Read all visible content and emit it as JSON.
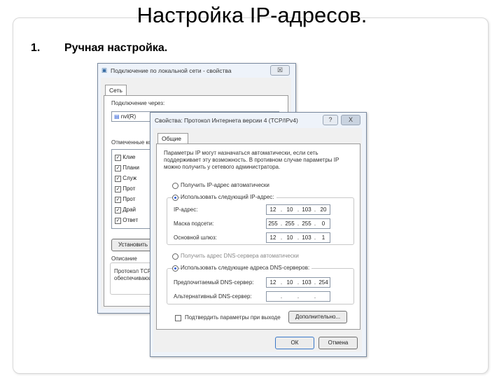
{
  "slide": {
    "title": "Настройка IP-адресов.",
    "item_number": "1.",
    "item_text": "Ручная настройка."
  },
  "back_window": {
    "title": "Подключение по локальной сети - свойства",
    "close": "☒",
    "tab": "Сеть",
    "connect_using_label": "Подключение через:",
    "adapter_name": "nvl(R)",
    "components_label": "Отмеченные компоненты используются этим подключением:",
    "items": [
      "Клие",
      "Плани",
      "Служ",
      "Прот",
      "Прот",
      "Драй",
      "Ответ"
    ],
    "install_button": "Установить",
    "description_label": "Описание",
    "description_text": "Протокол TCP/IP - стандартный протокол сетей, обеспечивающий связь между..."
  },
  "front_window": {
    "title": "Свойства: Протокол Интернета версии 4 (TCP/IPv4)",
    "help": "?",
    "close": "X",
    "tab": "Общие",
    "intro": "Параметры IP могут назначаться автоматически, если сеть поддерживает эту возможность. В противном случае параметры IP можно получить у сетевого администратора.",
    "radio_ip_auto": "Получить IP-адрес автоматически",
    "radio_ip_manual": "Использовать следующий IP-адрес:",
    "ip_label": "IP-адрес:",
    "ip_value": [
      "12",
      "10",
      "103",
      "20"
    ],
    "mask_label": "Маска подсети:",
    "mask_value": [
      "255",
      "255",
      "255",
      "0"
    ],
    "gateway_label": "Основной шлюз:",
    "gateway_value": [
      "12",
      "10",
      "103",
      "1"
    ],
    "radio_dns_auto": "Получить адрес DNS-сервера автоматически",
    "radio_dns_manual": "Использовать следующие адреса DNS-серверов:",
    "dns_pref_label": "Предпочитаемый DNS-сервер:",
    "dns_pref_value": [
      "12",
      "10",
      "103",
      "254"
    ],
    "dns_alt_label": "Альтернативный DNS-сервер:",
    "dns_alt_value": [
      "",
      "",
      "",
      ""
    ],
    "validate_label": "Подтвердить параметры при выходе",
    "advanced_button": "Дополнительно...",
    "ok_button": "ОК",
    "cancel_button": "Отмена"
  }
}
